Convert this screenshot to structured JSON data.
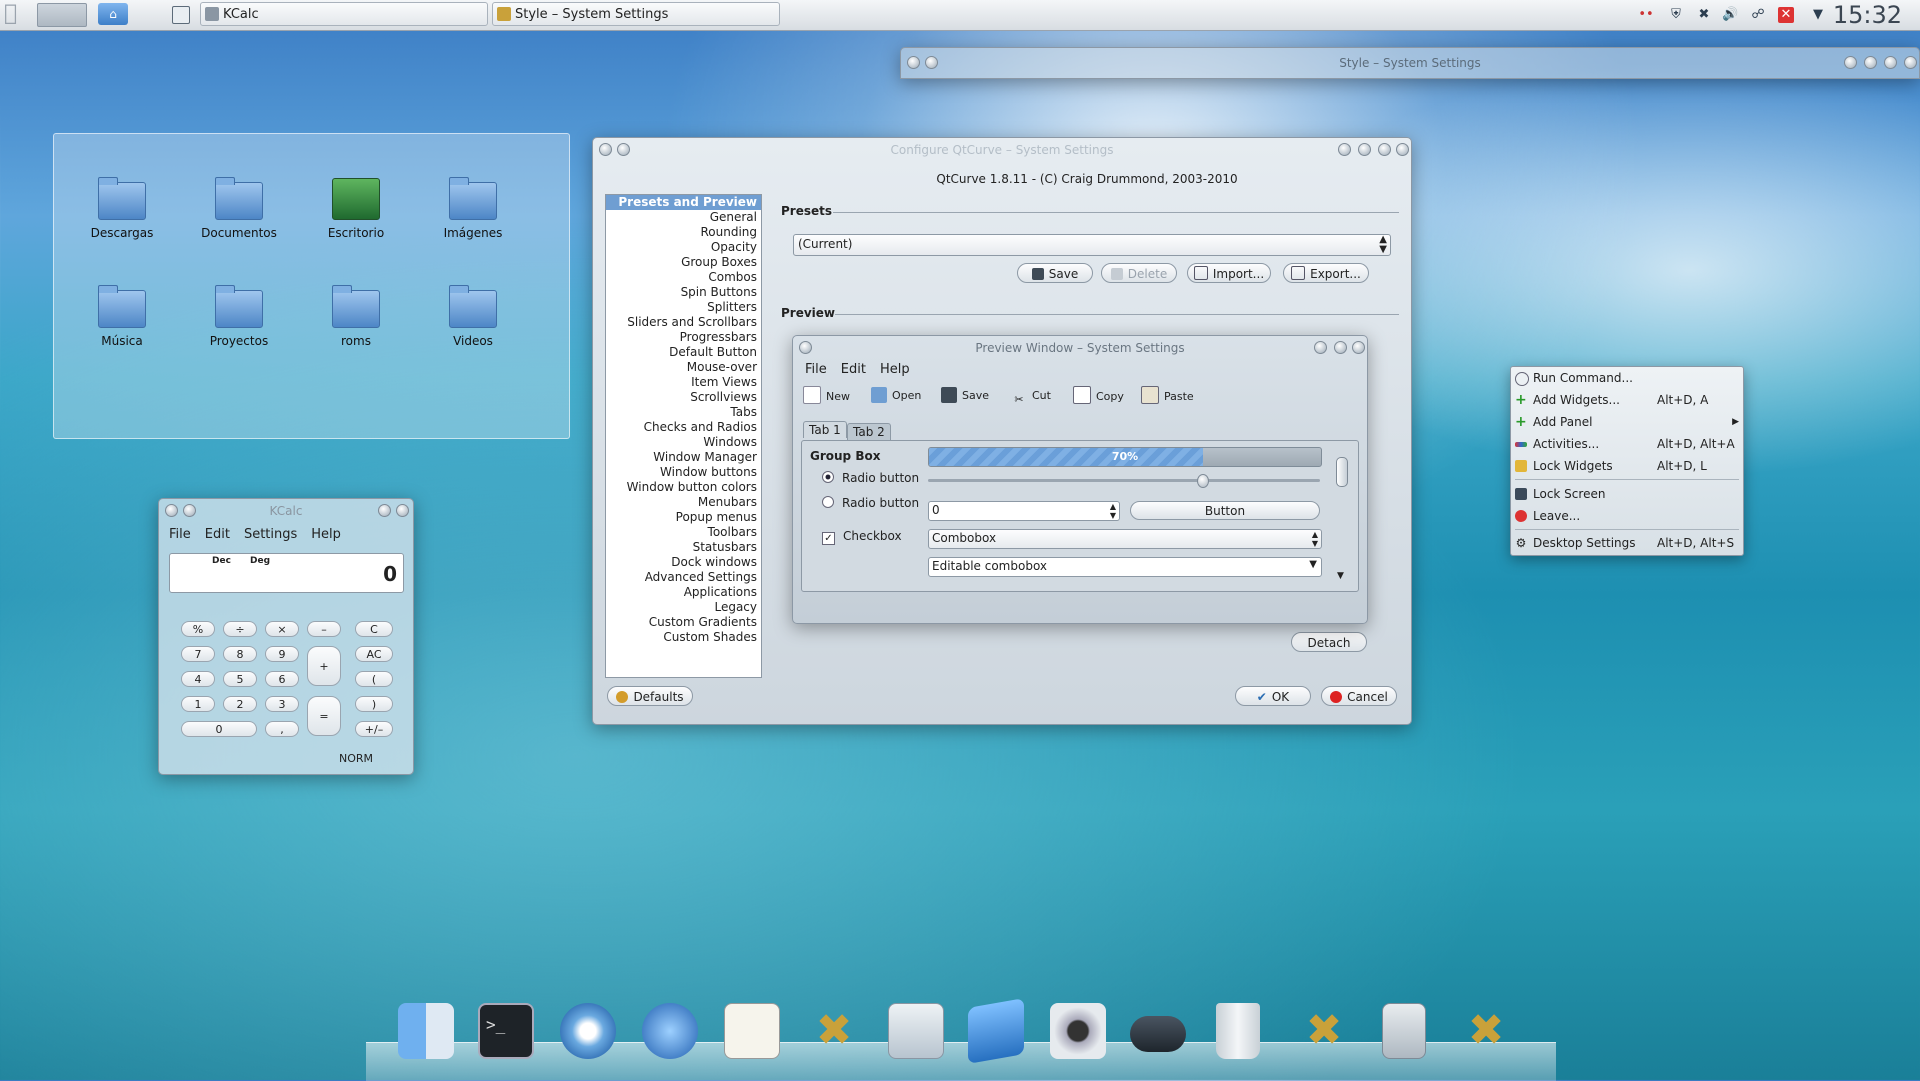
{
  "top_panel": {
    "tasks": [
      {
        "label": "KCalc"
      },
      {
        "label": "Style – System Settings"
      }
    ],
    "clock": "15:32"
  },
  "bg_window": {
    "title": "Style – System Settings"
  },
  "folder_view": {
    "items": [
      "Descargas",
      "Documentos",
      "Escritorio",
      "Imágenes",
      "Música",
      "Proyectos",
      "roms",
      "Videos"
    ]
  },
  "kcalc": {
    "title": "KCalc",
    "menu": [
      "File",
      "Edit",
      "Settings",
      "Help"
    ],
    "display_modes": [
      "Dec",
      "Deg"
    ],
    "display_value": "0",
    "keys": {
      "percent": "%",
      "divide": "÷",
      "multiply": "×",
      "minus": "–",
      "clear": "C",
      "n7": "7",
      "n8": "8",
      "n9": "9",
      "plus": "+",
      "allclear": "AC",
      "n4": "4",
      "n5": "5",
      "n6": "6",
      "lparen": "(",
      "n1": "1",
      "n2": "2",
      "n3": "3",
      "equals": "=",
      "rparen": ")",
      "n0": "0",
      "dot": ",",
      "plusminus": "+/–"
    },
    "status": "NORM"
  },
  "qtcurve": {
    "title": "Configure QtCurve – System Settings",
    "header": "QtCurve 1.8.11 - (C) Craig Drummond, 2003-2010",
    "sections": [
      "Presets and Preview",
      "General",
      "Rounding",
      "Opacity",
      "Group Boxes",
      "Combos",
      "Spin Buttons",
      "Splitters",
      "Sliders and Scrollbars",
      "Progressbars",
      "Default Button",
      "Mouse-over",
      "Item Views",
      "Scrollviews",
      "Tabs",
      "Checks and Radios",
      "Windows",
      "Window Manager",
      "Window buttons",
      "Window button colors",
      "Menubars",
      "Popup menus",
      "Toolbars",
      "Statusbars",
      "Dock windows",
      "Advanced Settings",
      "Applications",
      "Legacy",
      "Custom Gradients",
      "Custom Shades"
    ],
    "presets_label": "Presets",
    "preset_value": "(Current)",
    "preset_buttons": {
      "save": "Save",
      "delete": "Delete",
      "import": "Import...",
      "export": "Export..."
    },
    "preview_label": "Preview",
    "detach": "Detach",
    "defaults": "Defaults",
    "ok": "OK",
    "cancel": "Cancel"
  },
  "preview_window": {
    "title": "Preview Window – System Settings",
    "menu": [
      "File",
      "Edit",
      "Help"
    ],
    "toolbar": [
      "New",
      "Open",
      "Save",
      "Cut",
      "Copy",
      "Paste"
    ],
    "tabs": [
      "Tab 1",
      "Tab 2"
    ],
    "group_box": "Group Box",
    "radio1": "Radio button",
    "radio2": "Radio button",
    "checkbox": "Checkbox",
    "progress_text": "70%",
    "progress_value": 0.7,
    "slider_value": 0.7,
    "spin_value": "0",
    "button": "Button",
    "combobox": "Combobox",
    "editable_combobox": "Editable combobox"
  },
  "context_menu": {
    "items": [
      {
        "label": "Run Command...",
        "shortcut": ""
      },
      {
        "label": "Add Widgets...",
        "shortcut": "Alt+D, A"
      },
      {
        "label": "Add Panel",
        "shortcut": ""
      },
      {
        "label": "Activities...",
        "shortcut": "Alt+D, Alt+A"
      },
      {
        "label": "Lock Widgets",
        "shortcut": "Alt+D, L"
      },
      {
        "label": "Lock Screen",
        "shortcut": ""
      },
      {
        "label": "Leave...",
        "shortcut": ""
      },
      {
        "label": "Desktop Settings",
        "shortcut": "Alt+D, Alt+S"
      }
    ]
  },
  "colors": {
    "accent": "#6f9ed2",
    "panel": "#e3e7eb",
    "progress": "#7fb0e4"
  },
  "dock_icons": [
    "finder-icon",
    "terminal-icon",
    "safari-icon",
    "wolf-icon",
    "textedit-icon",
    "tools-icon",
    "preferences-icon",
    "cursor-icon",
    "camera-icon",
    "gamepad-icon",
    "trash-icon",
    "tools-icon",
    "calculator-icon",
    "tools-icon"
  ]
}
